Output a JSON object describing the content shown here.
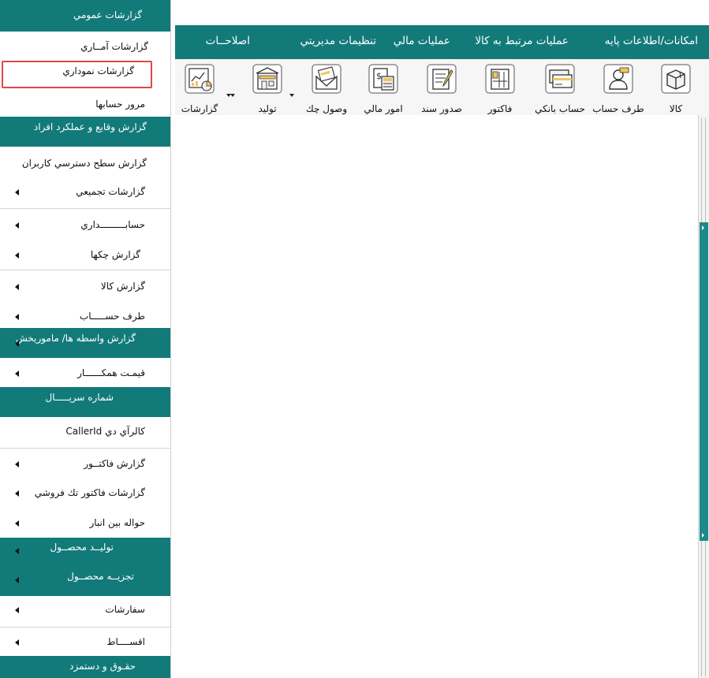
{
  "sidebar": {
    "header": "گزارشات عمومي",
    "items": [
      {
        "label": "گزارشات آمــاري"
      },
      {
        "label": "گزارشات نموداري"
      },
      {
        "label": "مرور حسابها"
      },
      {
        "label": "گزارش وقايع و عملكرد افراد"
      },
      {
        "label": "گزارش سطح دسترسي كاربران"
      },
      {
        "label": "گزارشات تجميعي"
      },
      {
        "label": "حسابـــــــــداري"
      },
      {
        "label": "گزارش چكها"
      },
      {
        "label": "گزارش كالا"
      },
      {
        "label": "طرف حســـــاب"
      },
      {
        "label": "گزارش واسطه ها/ ماموريخش"
      },
      {
        "label": "قيمـت همكــــــار"
      },
      {
        "label": "شماره سريـــــال"
      },
      {
        "label": "كالرآي دي CallerId"
      },
      {
        "label": "گزارش فاكتــور"
      },
      {
        "label": "گزارشات فاكتور تك فروشي"
      },
      {
        "label": "حواله بين انبار"
      },
      {
        "label": "توليــد محصــول"
      },
      {
        "label": "تجزيــه محصــول"
      },
      {
        "label": "سفارشات"
      },
      {
        "label": "اقســــاط"
      },
      {
        "label": "حقـوق و دستمزد"
      }
    ]
  },
  "menubar": {
    "items": [
      {
        "label": "امكانات/اطلاعات پايه"
      },
      {
        "label": "عمليات مرتبط به كالا"
      },
      {
        "label": "عمليات مالي"
      },
      {
        "label": "تنظيمات مديريتي"
      },
      {
        "label": "اصلاحــات"
      }
    ]
  },
  "toolbar": {
    "items": [
      {
        "label": "كالا",
        "icon": "box-icon"
      },
      {
        "label": "طرف حساب",
        "icon": "person-icon"
      },
      {
        "label": "حساب بانكي",
        "icon": "bank-card-icon"
      },
      {
        "label": "فاكتور",
        "icon": "invoice-icon"
      },
      {
        "label": "صدور سند",
        "icon": "document-pen-icon"
      },
      {
        "label": "امور مالي",
        "icon": "calculator-icon"
      },
      {
        "label": "وصول چك",
        "icon": "cheque-envelope-icon"
      },
      {
        "label": "توليد",
        "icon": "factory-icon"
      },
      {
        "label": "گزارشات",
        "icon": "report-chart-icon"
      }
    ]
  },
  "colors": {
    "teal": "#137a7a",
    "highlight": "#e0464a",
    "toolbar_bg": "#f6f6f6"
  }
}
